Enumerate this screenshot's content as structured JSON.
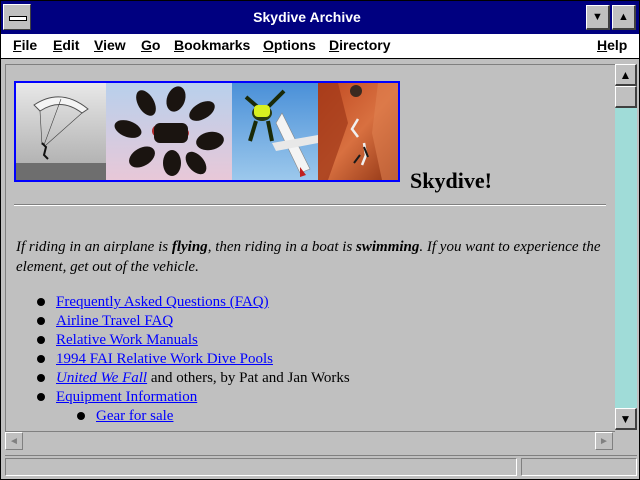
{
  "window": {
    "title": "Skydive Archive"
  },
  "menu": [
    {
      "label": "File",
      "key": "F",
      "rest": "ile"
    },
    {
      "label": "Edit",
      "key": "E",
      "rest": "dit"
    },
    {
      "label": "View",
      "key": "V",
      "rest": "iew"
    },
    {
      "label": "Go",
      "key": "G",
      "rest": "o"
    },
    {
      "label": "Bookmarks",
      "key": "B",
      "rest": "ookmarks"
    },
    {
      "label": "Options",
      "key": "O",
      "rest": "ptions"
    },
    {
      "label": "Directory",
      "key": "D",
      "rest": "irectory"
    },
    {
      "label": "Help",
      "key": "H",
      "rest": "elp"
    }
  ],
  "page": {
    "heading": "Skydive!",
    "quote_parts": [
      "If riding in an airplane is ",
      "flying",
      ", then riding in a boat is ",
      "swimming",
      ". If you want to experience the element, get out of the vehicle."
    ],
    "links": [
      {
        "text": "Frequently Asked Questions (FAQ)"
      },
      {
        "text": "Airline Travel FAQ"
      },
      {
        "text": "Relative Work Manuals"
      },
      {
        "text": "1994 FAI Relative Work Dive Pools"
      },
      {
        "text": "United We Fall",
        "suffix": " and others, by Pat and Jan Works"
      },
      {
        "text": "Equipment Information"
      },
      {
        "text": "Gear for sale"
      }
    ]
  },
  "colors": {
    "title_bar": "#000080",
    "link": "#0000ff",
    "background": "#c0c0c0",
    "scroll_track": "#a0dcd8"
  },
  "icons": [
    "system-menu-icon",
    "minimize-icon",
    "maximize-icon",
    "scroll-up-arrow-icon",
    "scroll-down-arrow-icon",
    "scroll-left-arrow-icon",
    "scroll-right-arrow-icon",
    "bullet-icon"
  ]
}
